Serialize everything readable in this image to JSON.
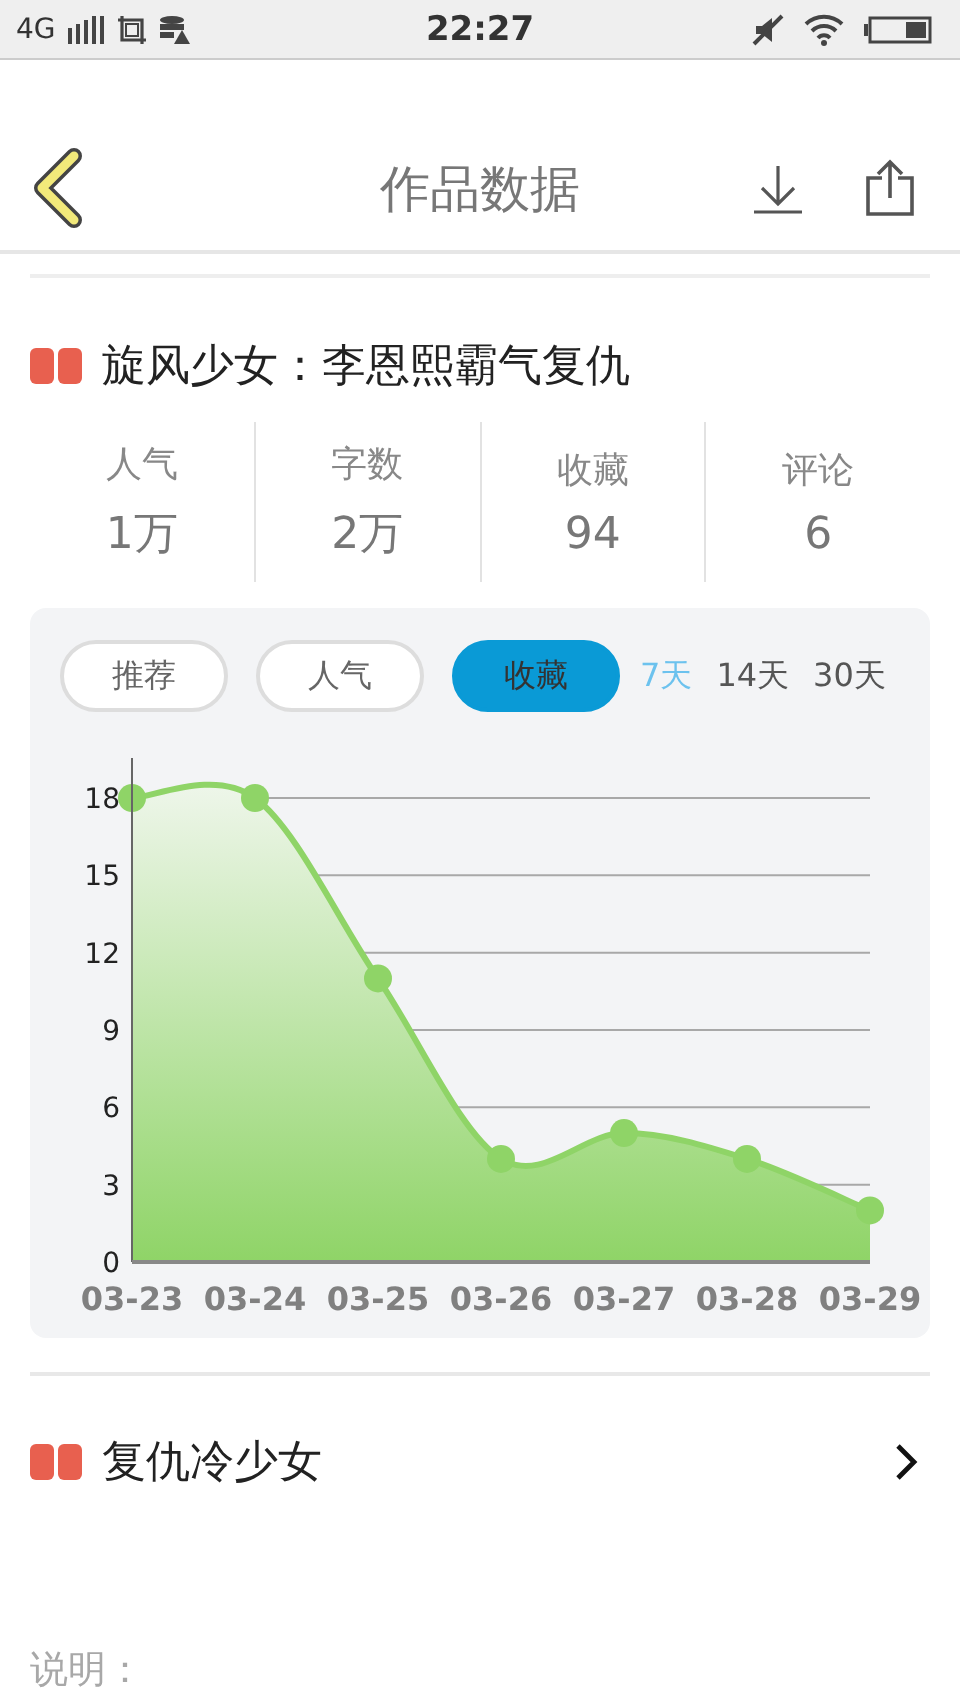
{
  "status_bar": {
    "network": "4G",
    "time": "22:27"
  },
  "header": {
    "title": "作品数据"
  },
  "works": [
    {
      "title": "旋风少女：李恩熙霸气复仇",
      "expanded": true,
      "stats": [
        {
          "label": "人气",
          "value": "1万"
        },
        {
          "label": "字数",
          "value": "2万"
        },
        {
          "label": "收藏",
          "value": "94"
        },
        {
          "label": "评论",
          "value": "6"
        }
      ],
      "metric_tabs": [
        {
          "label": "推荐",
          "selected": false
        },
        {
          "label": "人气",
          "selected": false
        },
        {
          "label": "收藏",
          "selected": true
        }
      ],
      "periods": [
        {
          "label": "7天",
          "selected": true
        },
        {
          "label": "14天",
          "selected": false
        },
        {
          "label": "30天",
          "selected": false
        }
      ],
      "chart_data": {
        "type": "area",
        "categories": [
          "03-23",
          "03-24",
          "03-25",
          "03-26",
          "03-27",
          "03-28",
          "03-29"
        ],
        "series": [
          {
            "color": "#8fd467",
            "values": [
              18,
              18,
              11,
              4,
              5,
              4,
              2
            ]
          }
        ],
        "grid": true,
        "ylim": [
          0,
          18
        ],
        "yticks": [
          0,
          3,
          6,
          9,
          12,
          15,
          18
        ]
      }
    },
    {
      "title": "复仇冷少女",
      "expanded": false
    }
  ],
  "note": {
    "label": "说明："
  }
}
